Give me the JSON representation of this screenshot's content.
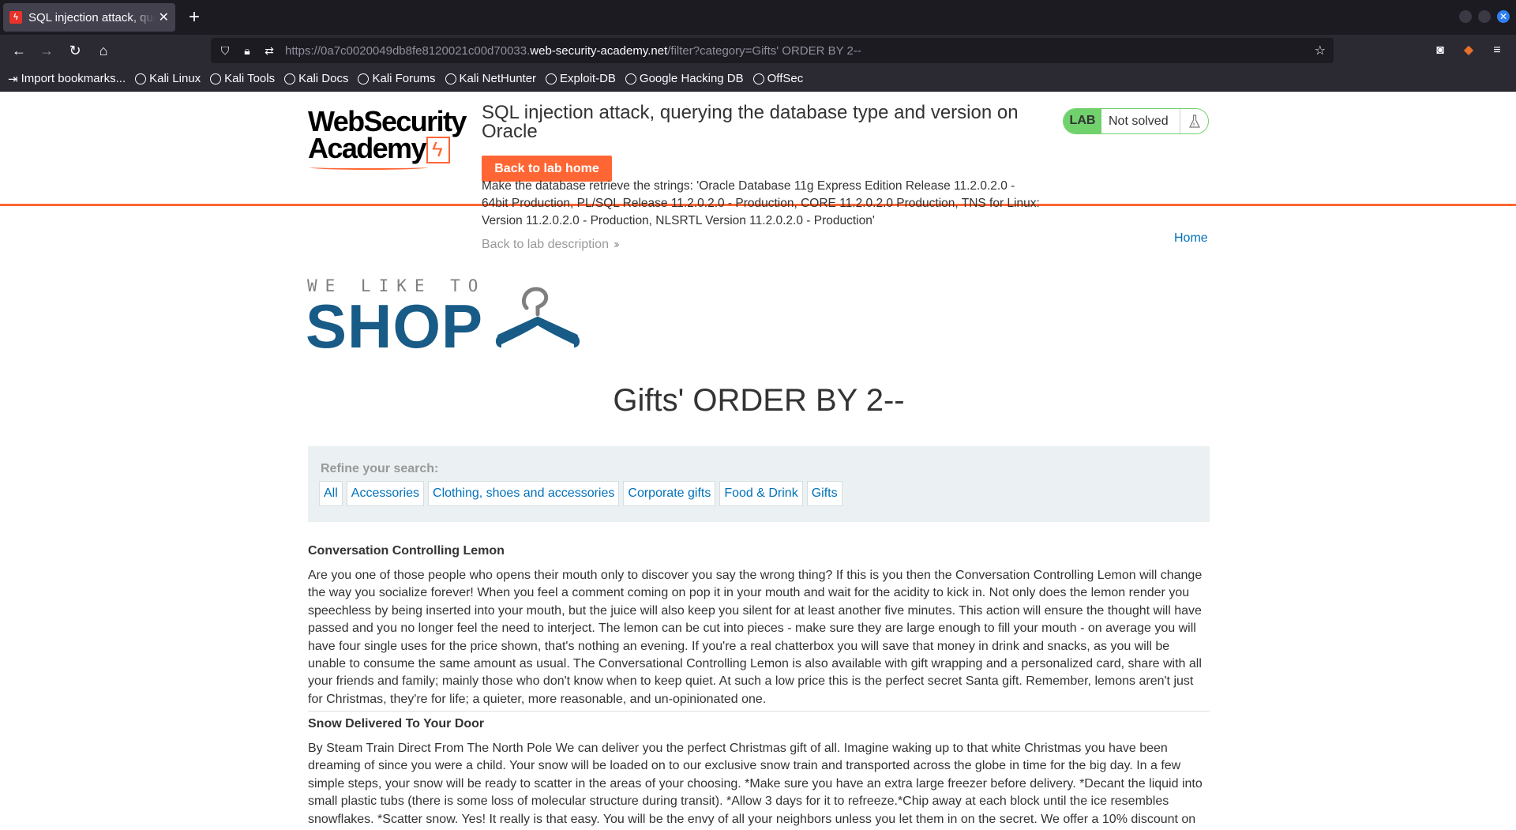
{
  "browser": {
    "tab_title": "SQL injection attack, querying",
    "url_prefix": "https://0a7c0020049db8fe8120021c00d70033.",
    "url_domain": "web-security-academy.net",
    "url_path": "/filter?category=Gifts' ORDER BY 2--",
    "bookmarks": [
      "Import bookmarks...",
      "Kali Linux",
      "Kali Tools",
      "Kali Docs",
      "Kali Forums",
      "Kali NetHunter",
      "Exploit-DB",
      "Google Hacking DB",
      "OffSec"
    ]
  },
  "header": {
    "logo_line1": "WebSecurity",
    "logo_line2": "Academy",
    "lab_title": "SQL injection attack, querying the database type and version on Oracle",
    "back_home_label": "Back to lab home",
    "lab_description": "Make the database retrieve the strings: 'Oracle Database 11g Express Edition Release 11.2.0.2.0 - 64bit Production, PL/SQL Release 11.2.0.2.0 - Production, CORE 11.2.0.2.0 Production, TNS for Linux: Version 11.2.0.2.0 - Production, NLSRTL Version 11.2.0.2.0 - Production'",
    "back_description_label": "Back to lab description",
    "badge_label": "LAB",
    "badge_status": "Not solved",
    "home_link": "Home",
    "accent_color": "#ff6633",
    "solved_color": "#70d16d"
  },
  "shop": {
    "tagline": "WE LIKE TO",
    "word": "SHOP",
    "brand_color": "#175b86"
  },
  "main": {
    "page_title": "Gifts' ORDER BY 2--",
    "refine_label": "Refine your search:",
    "filters": [
      "All",
      "Accessories",
      "Clothing, shoes and accessories",
      "Corporate gifts",
      "Food & Drink",
      "Gifts"
    ],
    "products": [
      {
        "name": "Conversation Controlling Lemon",
        "description": "Are you one of those people who opens their mouth only to discover you say the wrong thing? If this is you then the Conversation Controlling Lemon will change the way you socialize forever! When you feel a comment coming on pop it in your mouth and wait for the acidity to kick in. Not only does the lemon render you speechless by being inserted into your mouth, but the juice will also keep you silent for at least another five minutes. This action will ensure the thought will have passed and you no longer feel the need to interject. The lemon can be cut into pieces - make sure they are large enough to fill your mouth - on average you will have four single uses for the price shown, that's nothing an evening. If you're a real chatterbox you will save that money in drink and snacks, as you will be unable to consume the same amount as usual. The Conversational Controlling Lemon is also available with gift wrapping and a personalized card, share with all your friends and family; mainly those who don't know when to keep quiet. At such a low price this is the perfect secret Santa gift. Remember, lemons aren't just for Christmas, they're for life; a quieter, more reasonable, and un-opinionated one."
      },
      {
        "name": "Snow Delivered To Your Door",
        "description": "By Steam Train Direct From The North Pole We can deliver you the perfect Christmas gift of all. Imagine waking up to that white Christmas you have been dreaming of since you were a child. Your snow will be loaded on to our exclusive snow train and transported across the globe in time for the big day. In a few simple steps, your snow will be ready to scatter in the areas of your choosing. *Make sure you have an extra large freezer before delivery. *Decant the liquid into small plastic tubs (there is some loss of molecular structure during transit). *Allow 3 days for it to refreeze.*Chip away at each block until the ice resembles snowflakes. *Scatter snow. Yes! It really is that easy. You will be the envy of all your neighbors unless you let them in on the secret. We offer a 10% discount on"
      }
    ]
  }
}
